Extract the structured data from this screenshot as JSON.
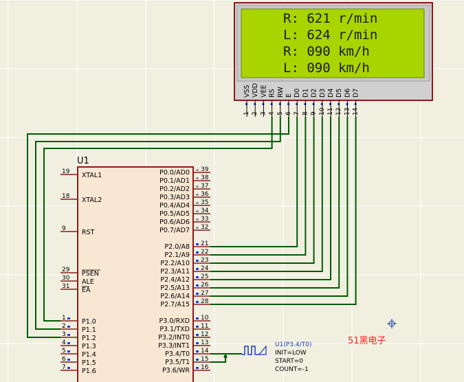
{
  "lcd": {
    "lines": [
      "R: 621 r/min",
      "L: 624 r/min",
      "R: 090 km/h",
      "L: 090 km/h"
    ],
    "pin_labels": [
      "VSS",
      "VDD",
      "VEE",
      "RS",
      "RW",
      "E",
      "D0",
      "D1",
      "D2",
      "D3",
      "D4",
      "D5",
      "D6",
      "D7"
    ],
    "pin_numbers": [
      "1",
      "2",
      "3",
      "4",
      "5",
      "6",
      "7",
      "8",
      "9",
      "10",
      "11",
      "12",
      "13",
      "14"
    ]
  },
  "mcu": {
    "ref": "U1",
    "left_pins": [
      {
        "num": "19",
        "label": "XTAL1"
      },
      {
        "num": "18",
        "label": "XTAL2"
      },
      {
        "num": "9",
        "label": "RST"
      },
      {
        "num": "29",
        "label": "PSEN"
      },
      {
        "num": "30",
        "label": "ALE"
      },
      {
        "num": "31",
        "label": "EA"
      },
      {
        "num": "1",
        "label": "P1.0"
      },
      {
        "num": "2",
        "label": "P1.1"
      },
      {
        "num": "3",
        "label": "P1.2"
      },
      {
        "num": "4",
        "label": "P1.3"
      },
      {
        "num": "5",
        "label": "P1.4"
      },
      {
        "num": "6",
        "label": "P1.5"
      },
      {
        "num": "7",
        "label": "P1.6"
      }
    ],
    "right_pins": [
      {
        "num": "39",
        "label": "P0.0/AD0"
      },
      {
        "num": "38",
        "label": "P0.1/AD1"
      },
      {
        "num": "37",
        "label": "P0.2/AD2"
      },
      {
        "num": "36",
        "label": "P0.3/AD3"
      },
      {
        "num": "35",
        "label": "P0.4/AD4"
      },
      {
        "num": "34",
        "label": "P0.5/AD5"
      },
      {
        "num": "33",
        "label": "P0.6/AD6"
      },
      {
        "num": "32",
        "label": "P0.7/AD7"
      },
      {
        "num": "21",
        "label": "P2.0/A8"
      },
      {
        "num": "22",
        "label": "P2.1/A9"
      },
      {
        "num": "23",
        "label": "P2.2/A10"
      },
      {
        "num": "24",
        "label": "P2.3/A11"
      },
      {
        "num": "25",
        "label": "P2.4/A12"
      },
      {
        "num": "26",
        "label": "P2.5/A13"
      },
      {
        "num": "27",
        "label": "P2.6/A14"
      },
      {
        "num": "28",
        "label": "P2.7/A15"
      },
      {
        "num": "10",
        "label": "P3.0/RXD"
      },
      {
        "num": "11",
        "label": "P3.1/TXD"
      },
      {
        "num": "12",
        "label": "P3.2/INT0"
      },
      {
        "num": "13",
        "label": "P3.3/INT1"
      },
      {
        "num": "14",
        "label": "P3.4/T0"
      },
      {
        "num": "15",
        "label": "P3.5/T1"
      },
      {
        "num": "16",
        "label": "P3.6/WR"
      }
    ]
  },
  "generator": {
    "lines": [
      "U1(P3.4/T0)",
      "INIT=LOW",
      "START=0",
      "COUNT=-1"
    ]
  },
  "watermark": "51黑电子",
  "colors": {
    "background": "#f0efe0",
    "grid": "#ffffff",
    "wire": "#005a00",
    "component_border": "#8b1a1a",
    "lcd_screen": "#a8d400",
    "chip_fill": "#f7e7d3",
    "pin_marker": "#2040e0",
    "watermark": "#ff2020"
  }
}
